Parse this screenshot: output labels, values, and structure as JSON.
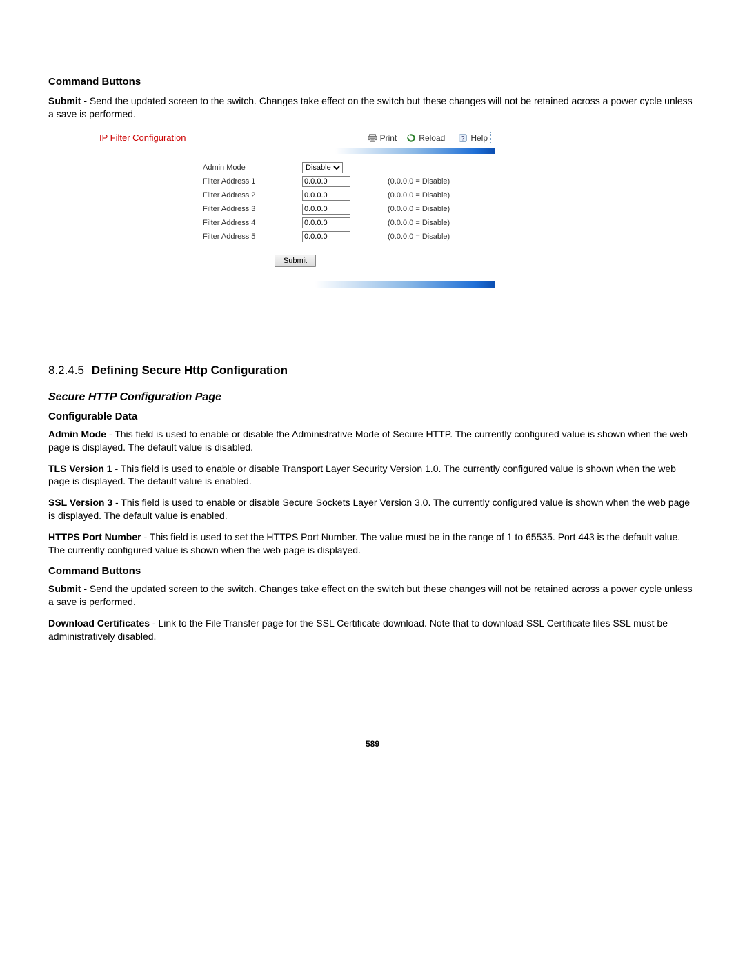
{
  "top": {
    "cmd_buttons_heading": "Command Buttons",
    "submit_label": "Submit",
    "submit_desc": " - Send the updated screen to the switch. Changes take effect on the switch but these changes will not be retained across a power cycle unless a save is performed."
  },
  "panel": {
    "title": "IP Filter Configuration",
    "print": "Print",
    "reload": "Reload",
    "help": "Help",
    "admin_mode_label": "Admin Mode",
    "admin_mode_value": "Disable",
    "rows": [
      {
        "label": "Filter Address 1",
        "value": "0.0.0.0",
        "hint": "(0.0.0.0 = Disable)"
      },
      {
        "label": "Filter Address 2",
        "value": "0.0.0.0",
        "hint": "(0.0.0.0 = Disable)"
      },
      {
        "label": "Filter Address 3",
        "value": "0.0.0.0",
        "hint": "(0.0.0.0 = Disable)"
      },
      {
        "label": "Filter Address 4",
        "value": "0.0.0.0",
        "hint": "(0.0.0.0 = Disable)"
      },
      {
        "label": "Filter Address 5",
        "value": "0.0.0.0",
        "hint": "(0.0.0.0 = Disable)"
      }
    ],
    "submit": "Submit"
  },
  "section": {
    "number": "8.2.4.5",
    "title": "Defining Secure Http Configuration",
    "page_title": "Secure HTTP Configuration Page",
    "config_data_heading": "Configurable Data",
    "fields": [
      {
        "name": "Admin Mode",
        "desc": " - This field is used to enable or disable the Administrative Mode of Secure HTTP. The currently configured value is shown when the web page is displayed. The default value is disabled."
      },
      {
        "name": "TLS Version 1",
        "desc": " - This field is used to enable or disable Transport Layer Security Version 1.0. The currently configured value is shown when the web page is displayed. The default value is enabled."
      },
      {
        "name": "SSL Version 3",
        "desc": " - This field is used to enable or disable Secure Sockets Layer Version 3.0. The currently configured value is shown when the web page is displayed. The default value is enabled."
      },
      {
        "name": "HTTPS Port Number",
        "desc": " - This field is used to set the HTTPS Port Number. The value must be in the range of 1 to 65535. Port 443 is the default value. The currently configured value is shown when the web page is displayed."
      }
    ],
    "cmd_buttons_heading": "Command Buttons",
    "submit_label": "Submit",
    "submit_desc": " - Send the updated screen to the switch. Changes take effect on the switch but these changes will not be retained across a power cycle unless a save is performed.",
    "download_label": "Download Certificates",
    "download_desc": " - Link to the File Transfer page for the SSL Certificate download. Note that to download SSL Certificate files SSL must be administratively disabled."
  },
  "page_number": "589"
}
